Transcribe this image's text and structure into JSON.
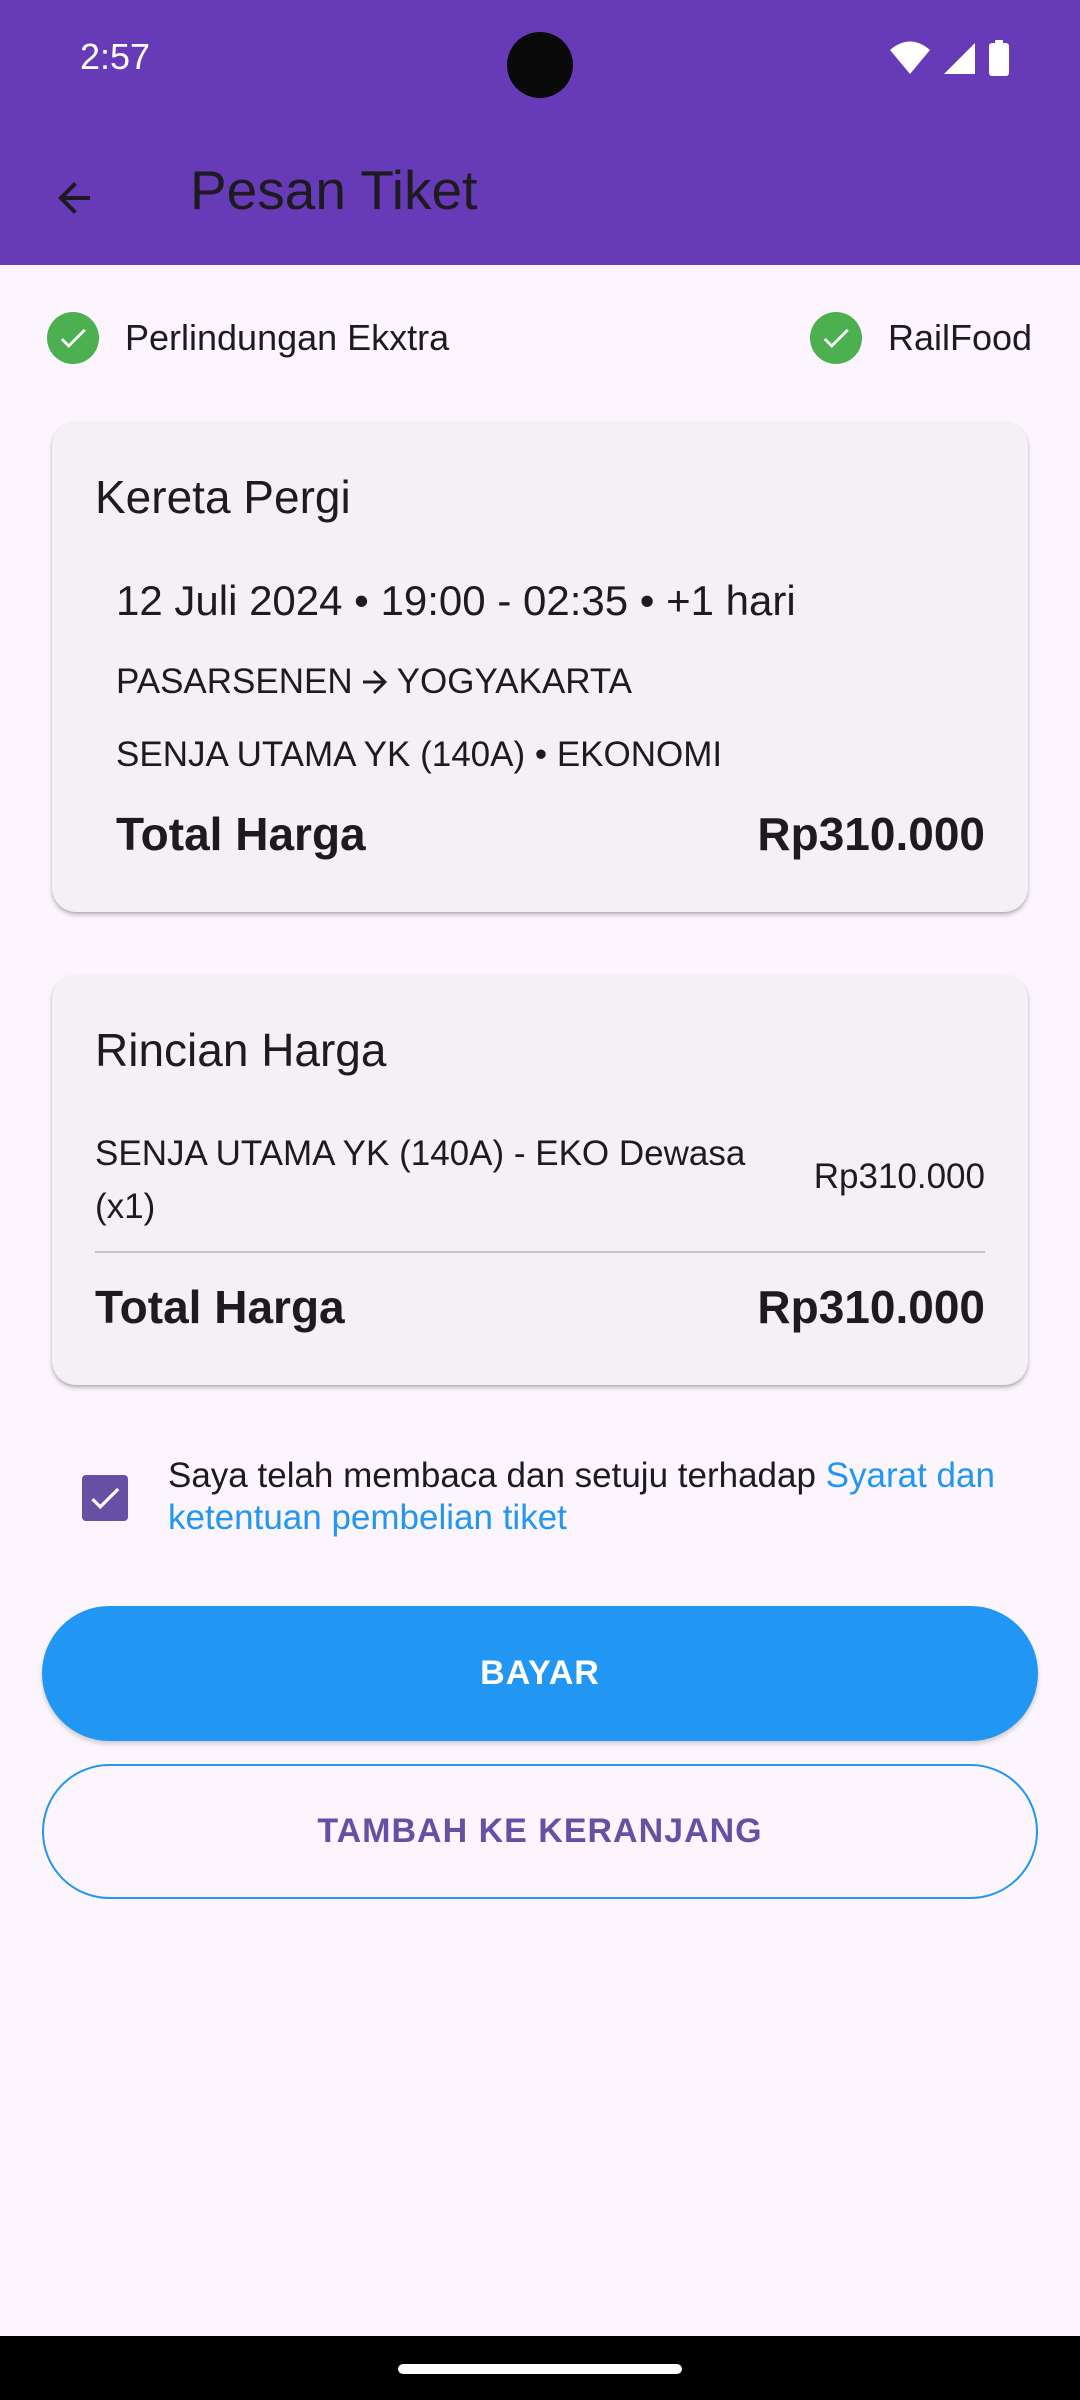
{
  "status_bar": {
    "time": "2:57"
  },
  "app_bar": {
    "title": "Pesan Tiket",
    "back_icon": "arrow-back-icon"
  },
  "extras": [
    {
      "label": "Perlindungan Ekxtra",
      "icon": "check-circle-icon",
      "checked": true
    },
    {
      "label": "RailFood",
      "icon": "check-circle-icon",
      "checked": true
    }
  ],
  "trip_card": {
    "title": "Kereta Pergi",
    "date_time": "12 Juli 2024 • 19:00 - 02:35 • +1 hari",
    "origin": "PASARSENEN",
    "destination": "YOGYAKARTA",
    "train": "SENJA UTAMA YK (140A) • EKONOMI",
    "total_label": "Total Harga",
    "total_value": "Rp310.000"
  },
  "price_card": {
    "title": "Rincian Harga",
    "item_name": "SENJA UTAMA YK (140A) - EKO Dewasa (x1)",
    "item_price": "Rp310.000",
    "total_label": "Total Harga",
    "total_value": "Rp310.000"
  },
  "agreement": {
    "checked": true,
    "text": "Saya telah membaca dan setuju terhadap ",
    "link": "Syarat dan ketentuan pembelian tiket"
  },
  "buttons": {
    "pay": "BAYAR",
    "add_to_cart": "TAMBAH KE KERANJANG"
  },
  "colors": {
    "app_bar": "#673ab7",
    "primary_button": "#2196f3",
    "check_green": "#4caf50",
    "checkbox": "#6750a4",
    "link": "#2196f3",
    "background": "#fcf5fd"
  }
}
